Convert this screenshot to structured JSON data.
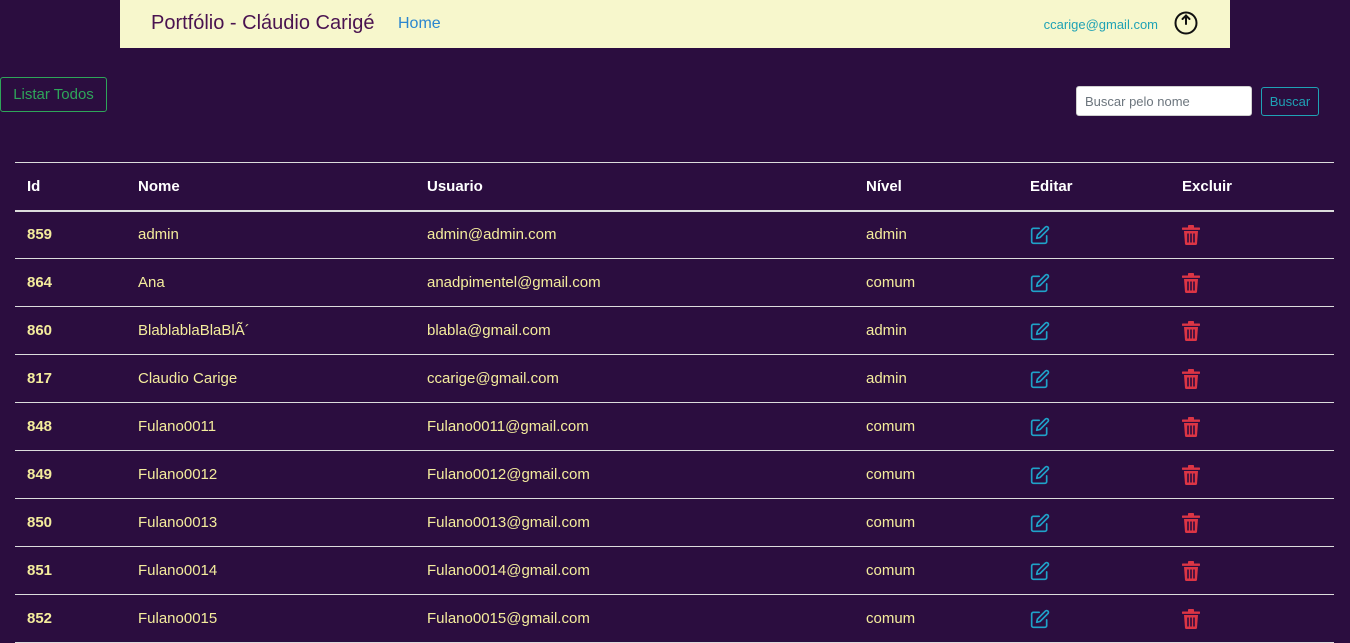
{
  "navbar": {
    "brand": "Portfólio - Cláudio Carigé",
    "home_label": "Home",
    "user_email": "ccarige@gmail.com",
    "logout_icon": "power-icon"
  },
  "toolbar": {
    "list_all_label": "Listar Todos",
    "search_placeholder": "Buscar pelo nome",
    "search_value": "",
    "search_button_label": "Buscar"
  },
  "table": {
    "headers": {
      "id": "Id",
      "nome": "Nome",
      "usuario": "Usuario",
      "nivel": "Nível",
      "editar": "Editar",
      "excluir": "Excluir"
    },
    "edit_icon": "edit-icon",
    "delete_icon": "trash-icon",
    "rows": [
      {
        "id": "859",
        "nome": "admin",
        "usuario": "admin@admin.com",
        "nivel": "admin"
      },
      {
        "id": "864",
        "nome": "Ana",
        "usuario": "anadpimentel@gmail.com",
        "nivel": "comum"
      },
      {
        "id": "860",
        "nome": "BlablablaBlaBlÃ´",
        "usuario": "blabla@gmail.com",
        "nivel": "admin"
      },
      {
        "id": "817",
        "nome": "Claudio Carige",
        "usuario": "ccarige@gmail.com",
        "nivel": "admin"
      },
      {
        "id": "848",
        "nome": "Fulano0011",
        "usuario": "Fulano0011@gmail.com",
        "nivel": "comum"
      },
      {
        "id": "849",
        "nome": "Fulano0012",
        "usuario": "Fulano0012@gmail.com",
        "nivel": "comum"
      },
      {
        "id": "850",
        "nome": "Fulano0013",
        "usuario": "Fulano0013@gmail.com",
        "nivel": "comum"
      },
      {
        "id": "851",
        "nome": "Fulano0014",
        "usuario": "Fulano0014@gmail.com",
        "nivel": "comum"
      },
      {
        "id": "852",
        "nome": "Fulano0015",
        "usuario": "Fulano0015@gmail.com",
        "nivel": "comum"
      }
    ]
  },
  "colors": {
    "background": "#2b0d3f",
    "navbar": "#f7f7cc",
    "cell_text": "#f4ec9c",
    "edit_icon": "#1fa2c9",
    "delete_icon": "#dc3545",
    "success": "#2fa55a",
    "info": "#1fa2b5"
  }
}
